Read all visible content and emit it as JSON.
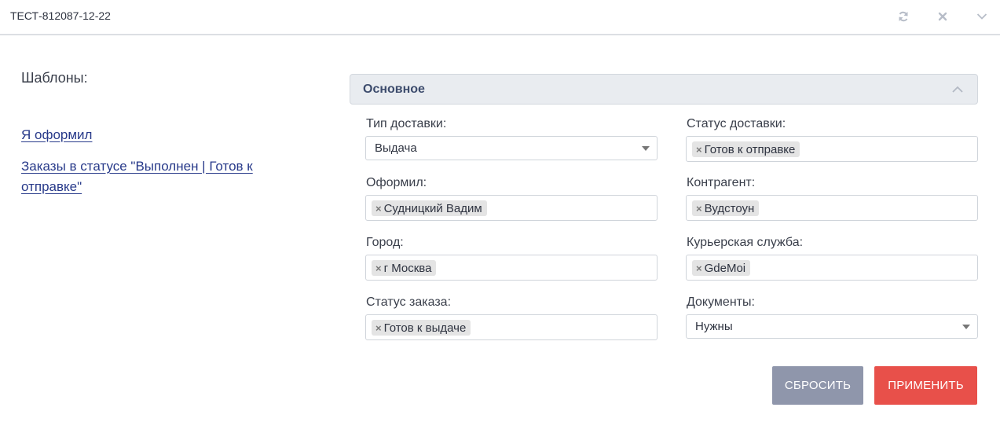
{
  "header": {
    "title": "ТЕСТ-812087-12-22",
    "icons": [
      "refresh-icon",
      "close-icon",
      "chevron-down-icon"
    ]
  },
  "templates": {
    "title": "Шаблоны:",
    "links": [
      "Я оформил",
      "Заказы в статусе \"Выполнен | Готов к отправке\""
    ]
  },
  "section": {
    "title": "Основное"
  },
  "fields": {
    "delivery_type": {
      "label": "Тип доставки:",
      "value": "Выдача"
    },
    "delivery_status": {
      "label": "Статус доставки:",
      "tags": [
        "Готов к отправке"
      ]
    },
    "issued_by": {
      "label": "Оформил:",
      "tags": [
        "Судницкий Вадим"
      ]
    },
    "counterparty": {
      "label": "Контрагент:",
      "tags": [
        "Вудстоун"
      ]
    },
    "city": {
      "label": "Город:",
      "tags": [
        "г Москва"
      ]
    },
    "courier": {
      "label": "Курьерская служба:",
      "tags": [
        "GdeMoi"
      ]
    },
    "order_status": {
      "label": "Статус заказа:",
      "tags": [
        "Готов к выдаче"
      ]
    },
    "documents": {
      "label": "Документы:",
      "value": "Нужны"
    }
  },
  "tag_remove_glyph": "×",
  "buttons": {
    "reset": "СБРОСИТЬ",
    "apply": "ПРИМЕНИТЬ"
  },
  "colors": {
    "link": "#283a8a",
    "section_bg": "#e9ecf0",
    "reset_bg": "#8f96ab",
    "apply_bg": "#e8504a"
  }
}
